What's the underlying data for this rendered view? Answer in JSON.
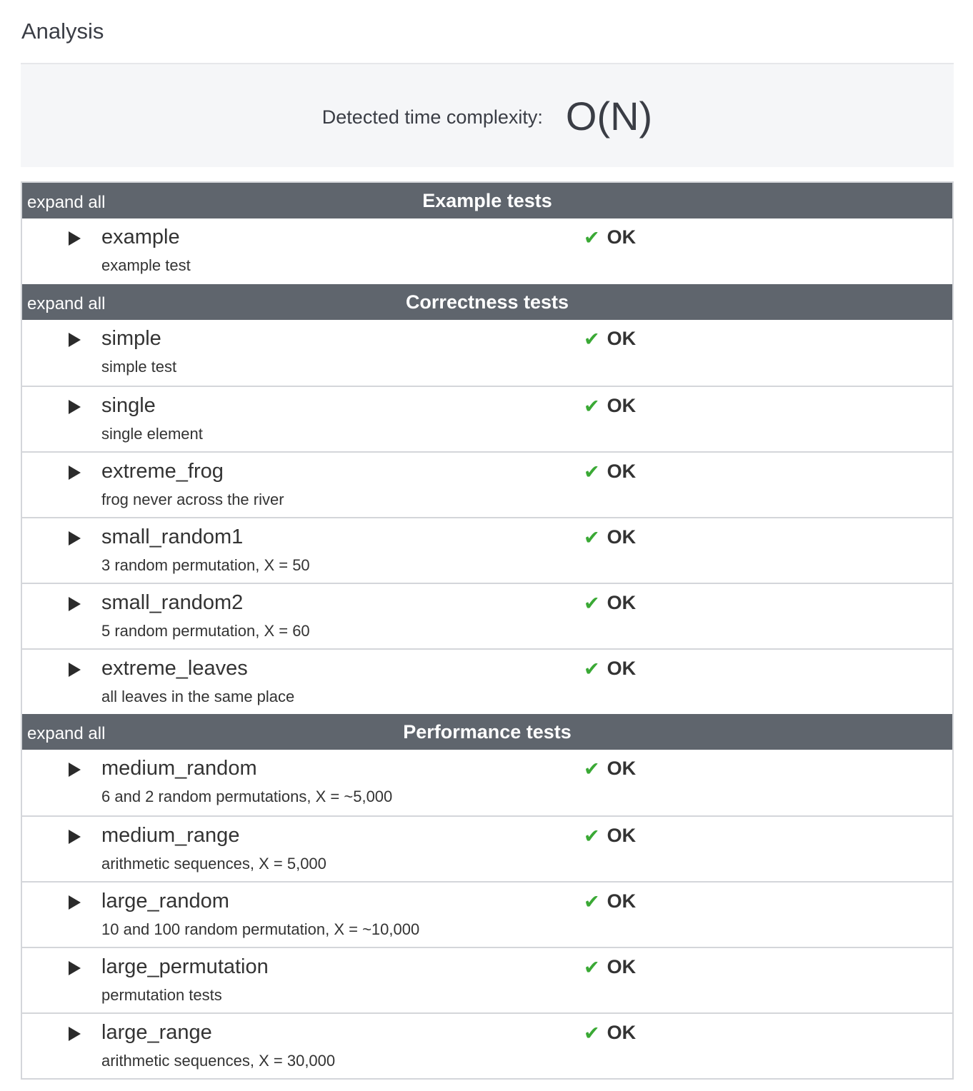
{
  "page_title": "Analysis",
  "complexity": {
    "label": "Detected time complexity:",
    "value": "O(N)"
  },
  "expand_label": "expand all",
  "colors": {
    "header_bg": "#5f656d",
    "ok_check": "#3aa935"
  },
  "groups": [
    {
      "title": "Example tests",
      "tests": [
        {
          "name": "example",
          "description": "example test",
          "status": "OK",
          "icon": "check-icon"
        }
      ]
    },
    {
      "title": "Correctness tests",
      "tests": [
        {
          "name": "simple",
          "description": "simple test",
          "status": "OK",
          "icon": "check-icon"
        },
        {
          "name": "single",
          "description": "single element",
          "status": "OK",
          "icon": "check-icon"
        },
        {
          "name": "extreme_frog",
          "description": "frog never across the river",
          "status": "OK",
          "icon": "check-icon"
        },
        {
          "name": "small_random1",
          "description": "3 random permutation, X = 50",
          "status": "OK",
          "icon": "check-icon"
        },
        {
          "name": "small_random2",
          "description": "5 random permutation, X = 60",
          "status": "OK",
          "icon": "check-icon"
        },
        {
          "name": "extreme_leaves",
          "description": "all leaves in the same place",
          "status": "OK",
          "icon": "check-icon"
        }
      ]
    },
    {
      "title": "Performance tests",
      "tests": [
        {
          "name": "medium_random",
          "description": "6 and 2 random permutations, X = ~5,000",
          "status": "OK",
          "icon": "check-icon"
        },
        {
          "name": "medium_range",
          "description": "arithmetic sequences, X = 5,000",
          "status": "OK",
          "icon": "check-icon"
        },
        {
          "name": "large_random",
          "description": "10 and 100 random permutation, X = ~10,000",
          "status": "OK",
          "icon": "check-icon"
        },
        {
          "name": "large_permutation",
          "description": "permutation tests",
          "status": "OK",
          "icon": "check-icon"
        },
        {
          "name": "large_range",
          "description": "arithmetic sequences, X = 30,000",
          "status": "OK",
          "icon": "check-icon"
        }
      ]
    }
  ]
}
